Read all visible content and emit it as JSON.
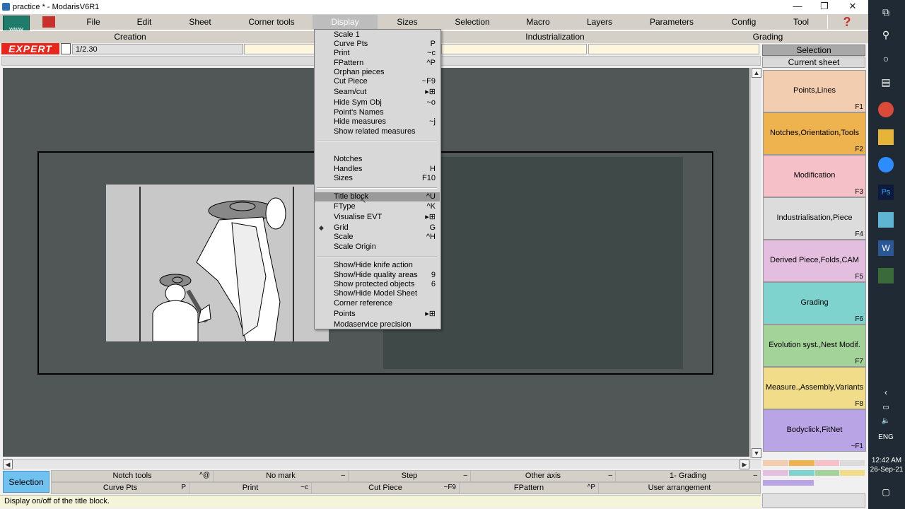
{
  "window": {
    "title": "practice * - ModarisV6R1"
  },
  "menu": [
    "File",
    "Edit",
    "Sheet",
    "Corner tools",
    "Display",
    "Sizes",
    "Selection",
    "Macro",
    "Layers",
    "Parameters",
    "Config",
    "Tool"
  ],
  "functions": [
    "Creation",
    "Industrialization",
    "Grading"
  ],
  "toolbar": {
    "expert_label": "EXPERT",
    "scale_value": "1/2.30",
    "www_label": "www",
    "help_icon": "?"
  },
  "display_menu": [
    {
      "label": "Scale 1",
      "shortcut": ""
    },
    {
      "label": "Curve Pts",
      "shortcut": "P"
    },
    {
      "label": "Print",
      "shortcut": "~c"
    },
    {
      "label": "FPattern",
      "shortcut": "^P"
    },
    {
      "label": "Orphan pieces",
      "shortcut": ""
    },
    {
      "label": "Cut Piece",
      "shortcut": "~F9"
    },
    {
      "label": "Seam/cut",
      "shortcut": "▸⊞"
    },
    {
      "label": "Hide Sym Obj",
      "shortcut": "~o"
    },
    {
      "label": "Point's Names",
      "shortcut": ""
    },
    {
      "label": "Hide measures",
      "shortcut": "~j"
    },
    {
      "label": "Show related measures",
      "shortcut": ""
    },
    {
      "label": "Notches",
      "shortcut": ""
    },
    {
      "label": "Handles",
      "shortcut": "H"
    },
    {
      "label": "Sizes",
      "shortcut": "F10"
    },
    {
      "label": "Title block",
      "shortcut": "^U"
    },
    {
      "label": "FType",
      "shortcut": "^K"
    },
    {
      "label": "Visualise EVT",
      "shortcut": "▸⊞"
    },
    {
      "label": "Grid",
      "shortcut": "G"
    },
    {
      "label": "Scale",
      "shortcut": "^H"
    },
    {
      "label": "Scale Origin",
      "shortcut": ""
    },
    {
      "label": "Show/Hide knife action",
      "shortcut": ""
    },
    {
      "label": "Show/Hide quality areas",
      "shortcut": "9"
    },
    {
      "label": "Show protected objects",
      "shortcut": "6"
    },
    {
      "label": "Show/Hide Model Sheet",
      "shortcut": ""
    },
    {
      "label": "Corner reference",
      "shortcut": ""
    },
    {
      "label": "Points",
      "shortcut": "▸⊞"
    },
    {
      "label": "Modaservice precision",
      "shortcut": ""
    }
  ],
  "right_panel": {
    "selection": "Selection",
    "current_sheet": "Current sheet",
    "buttons": [
      {
        "label": "Points,Lines",
        "key": "F1",
        "color": "#f3cdb0"
      },
      {
        "label": "Notches,Orientation,Tools",
        "key": "F2",
        "color": "#eeb24f"
      },
      {
        "label": "Modification",
        "key": "F3",
        "color": "#f6c0c8"
      },
      {
        "label": "Industrialisation,Piece",
        "key": "F4",
        "color": "#dcdcdc"
      },
      {
        "label": "Derived Piece,Folds,CAM",
        "key": "F5",
        "color": "#e3bedf"
      },
      {
        "label": "Grading",
        "key": "F6",
        "color": "#7ed3cf"
      },
      {
        "label": "Evolution syst.,Nest Modif.",
        "key": "F7",
        "color": "#a4d39a"
      },
      {
        "label": "Measure.,Assembly,Variants",
        "key": "F8",
        "color": "#f1dc8a"
      },
      {
        "label": "Bodyclick,FitNet",
        "key": "~F1",
        "color": "#b9a4e6"
      }
    ]
  },
  "bottom": {
    "selection_button": "Selection",
    "row1": [
      {
        "label": "Notch tools",
        "sc": "^@"
      },
      {
        "label": "No mark",
        "sc": "‒"
      },
      {
        "label": "Step",
        "sc": "‒"
      },
      {
        "label": "Other axis",
        "sc": "‒"
      },
      {
        "label": "1- Grading",
        "sc": "‒"
      }
    ],
    "row2": [
      {
        "label": "Curve Pts",
        "sc": "P"
      },
      {
        "label": "Print",
        "sc": "~c"
      },
      {
        "label": "Cut Piece",
        "sc": "~F9"
      },
      {
        "label": "FPattern",
        "sc": "^P"
      },
      {
        "label": "User arrangement",
        "sc": ""
      }
    ]
  },
  "status": "Display on/off of the title block.",
  "taskbar": {
    "time": "12:42 AM",
    "date": "26-Sep-21",
    "lang": "ENG"
  }
}
